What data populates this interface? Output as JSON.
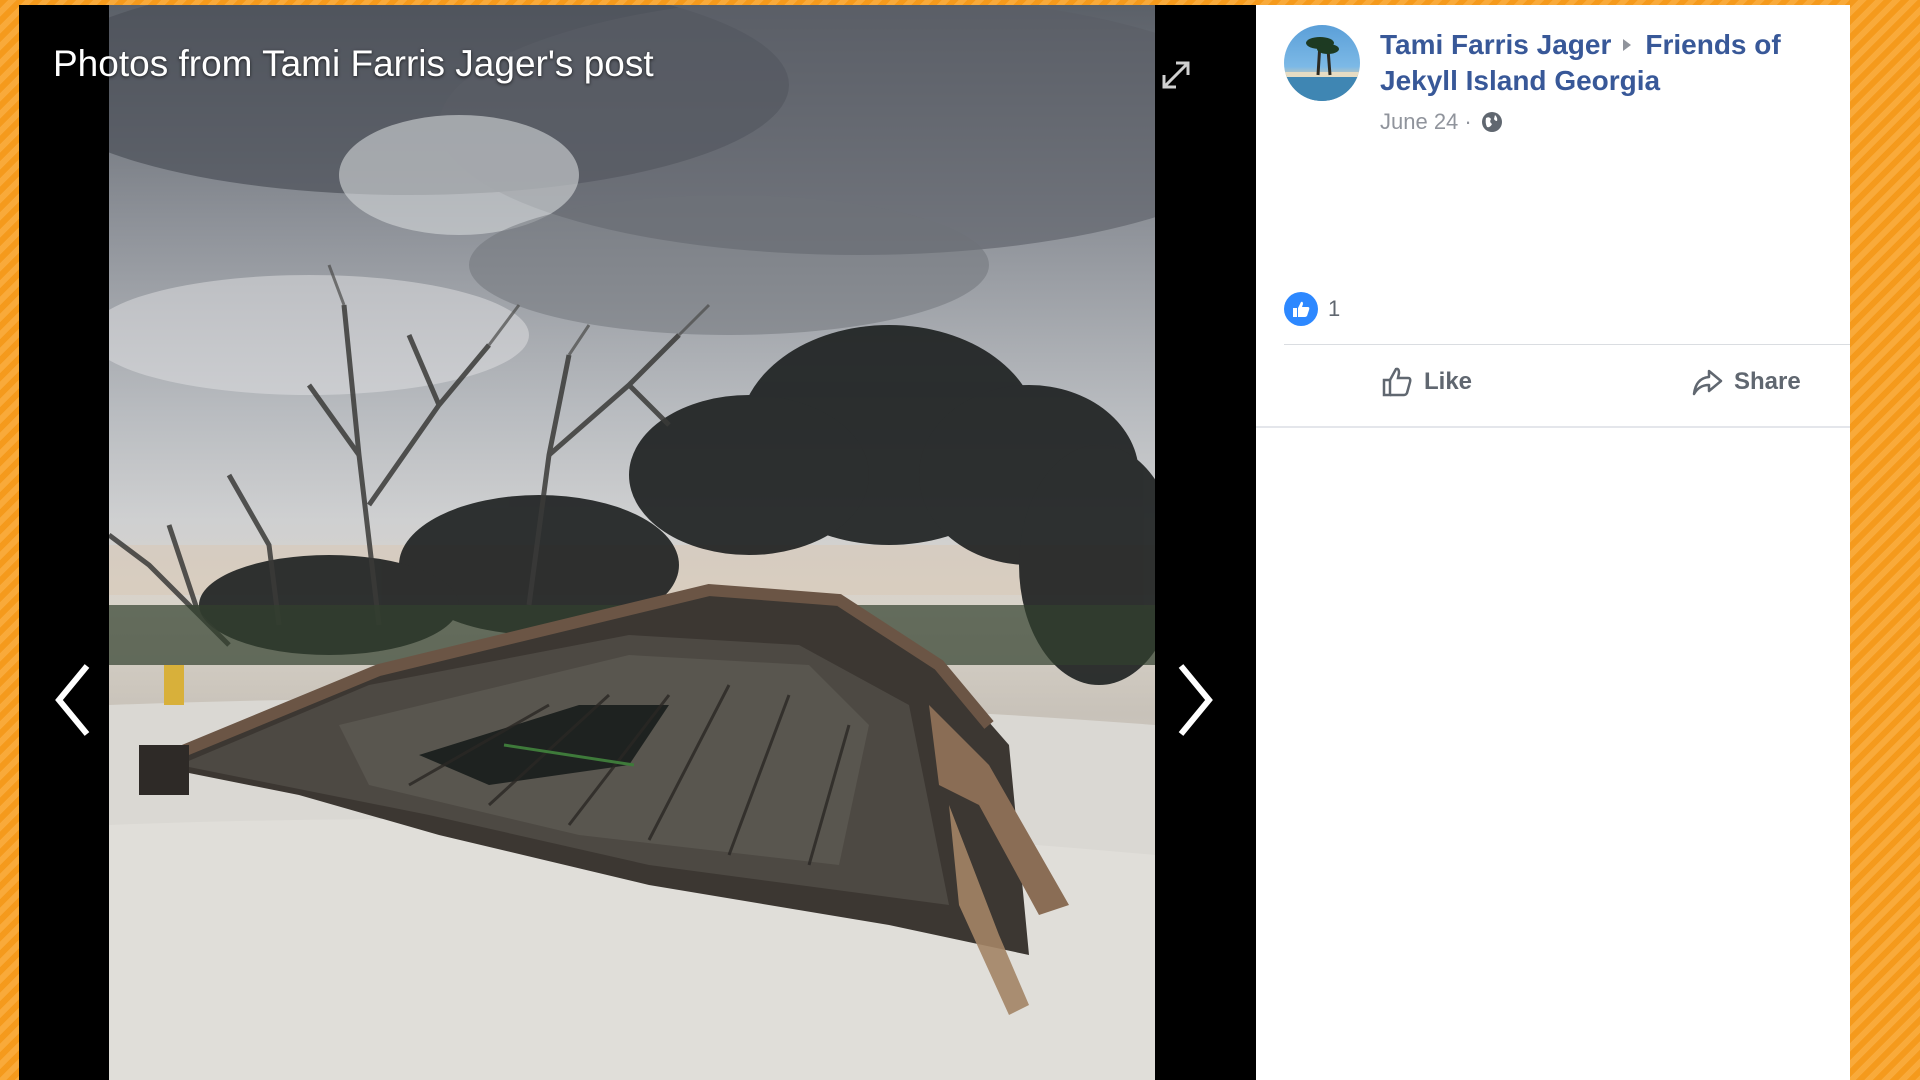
{
  "viewer": {
    "title": "Photos from Tami Farris Jager's post",
    "expand_icon": "expand-icon",
    "prev_icon": "chevron-left-icon",
    "next_icon": "chevron-right-icon"
  },
  "post": {
    "author": "Tami Farris Jager",
    "group": "Friends of Jekyll Island Georgia",
    "date": "June 24 ·",
    "privacy_icon": "globe-icon",
    "reaction_count": "1",
    "like_label": "Like",
    "share_label": "Share"
  },
  "colors": {
    "frame": "#f7a128",
    "link": "#385898",
    "like_blue": "#2d88ff",
    "muted": "#606770"
  }
}
